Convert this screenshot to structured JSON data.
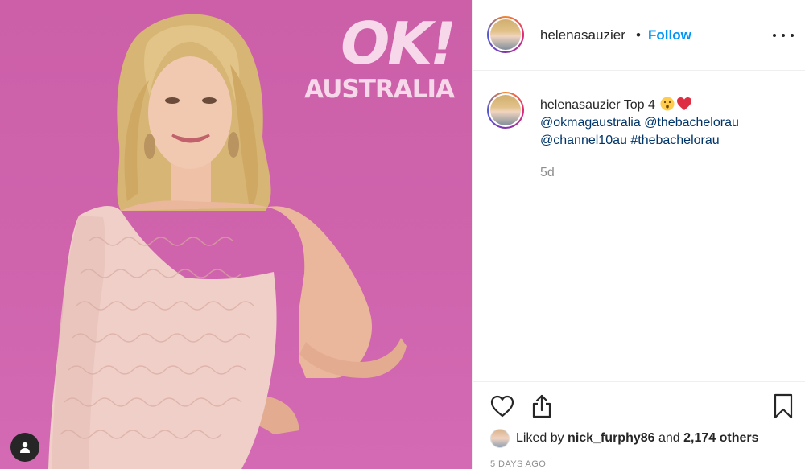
{
  "photo": {
    "brand_title": "OK!",
    "brand_country": "AUSTRALIA",
    "tagged_user_icon": "person-icon",
    "background_color": "#cf64ad"
  },
  "header": {
    "username": "helenasauzier",
    "separator": "•",
    "follow_label": "Follow",
    "more_icon": "more-horizontal-icon"
  },
  "caption": {
    "username": "helenasauzier",
    "text": "Top 4",
    "emojis": [
      "hushed-face-emoji",
      "red-heart-emoji"
    ],
    "mentions": [
      "@okmagaustralia",
      "@thebachelorau",
      "@channel10au"
    ],
    "hashtag": "#thebachelorau",
    "time_short": "5d"
  },
  "actions": {
    "like_icon": "heart-outline-icon",
    "share_icon": "share-icon",
    "save_icon": "bookmark-icon"
  },
  "likes": {
    "prefix": "Liked by",
    "user": "nick_furphy86",
    "conjunction": "and",
    "others": "2,174 others"
  },
  "post_date": "5 DAYS AGO",
  "colors": {
    "link_blue": "#003569",
    "follow_blue": "#0095f6",
    "muted": "#8e8e8e",
    "photo_pink": "#cf64ad"
  }
}
